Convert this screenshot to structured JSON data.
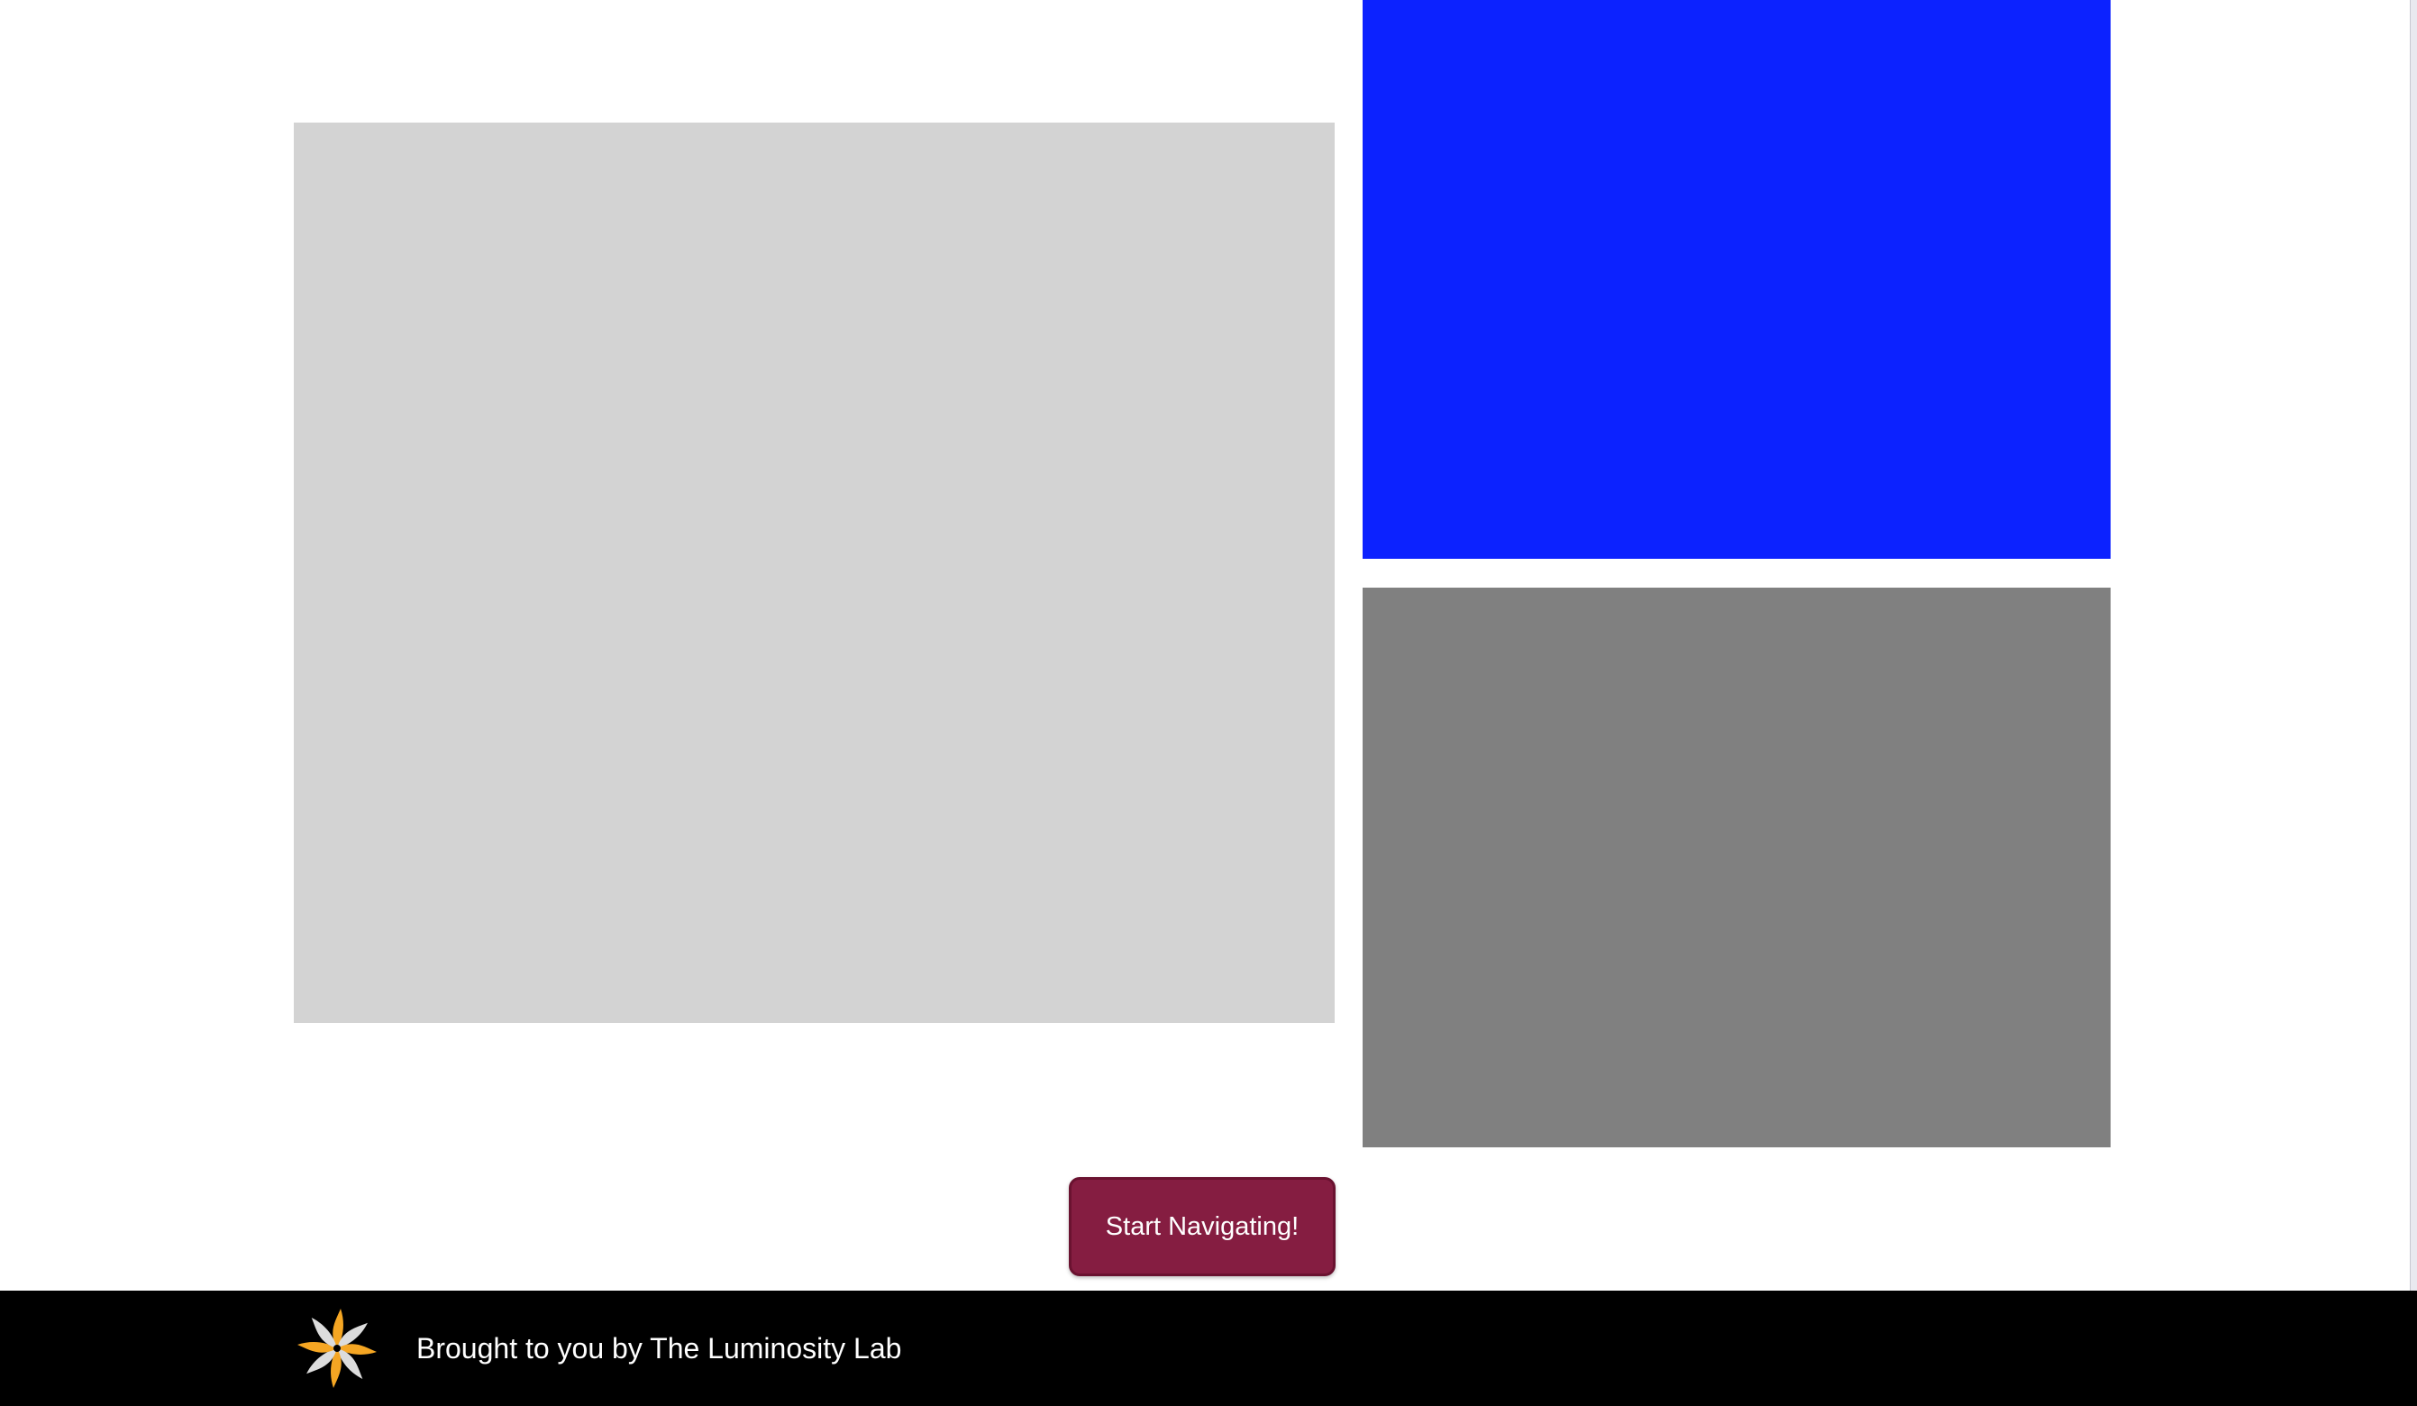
{
  "panels": {
    "light": {
      "color": "#d3d3d3"
    },
    "blue": {
      "color": "#0c22ff"
    },
    "gray": {
      "color": "#808080"
    }
  },
  "cta": {
    "label": "Start Navigating!",
    "color": "#851d41"
  },
  "footer": {
    "credit": "Brought to you by The Luminosity Lab",
    "logo_icon": "luminosity-lab-logo-icon",
    "logo_colors": [
      "#f5a623",
      "#dcdcdc"
    ]
  }
}
